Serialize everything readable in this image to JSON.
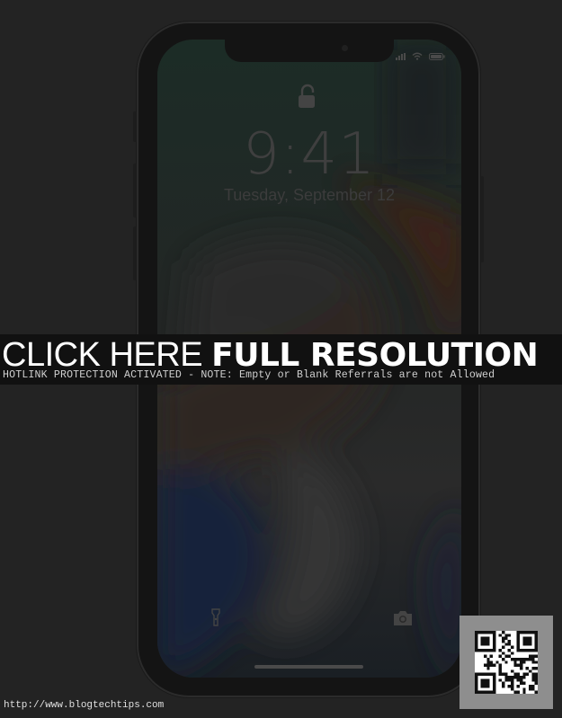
{
  "lock_screen": {
    "time": "9:41",
    "date": "Tuesday, September 12"
  },
  "banner": {
    "title_light": "CLICK HERE ",
    "title_bold": "FULL RESOLUTION",
    "subtitle": "HOTLINK PROTECTION ACTIVATED - NOTE: Empty or Blank Referrals are not Allowed"
  },
  "footer": {
    "url": "http://www.blogtechtips.com"
  },
  "icons": {
    "status": [
      "cellular-signal-icon",
      "wifi-icon",
      "battery-icon"
    ],
    "lock": "unlocked-padlock-icon",
    "bottom_left": "flashlight-icon",
    "bottom_right": "camera-icon",
    "watermark": "qr-code-icon"
  },
  "colors": {
    "background": "#232323",
    "banner_background": "#111111",
    "banner_text": "#ffffff",
    "wallpaper_orange": "#3a2418",
    "wallpaper_blue": "#18202e",
    "wallpaper_green": "#1b2a24"
  }
}
